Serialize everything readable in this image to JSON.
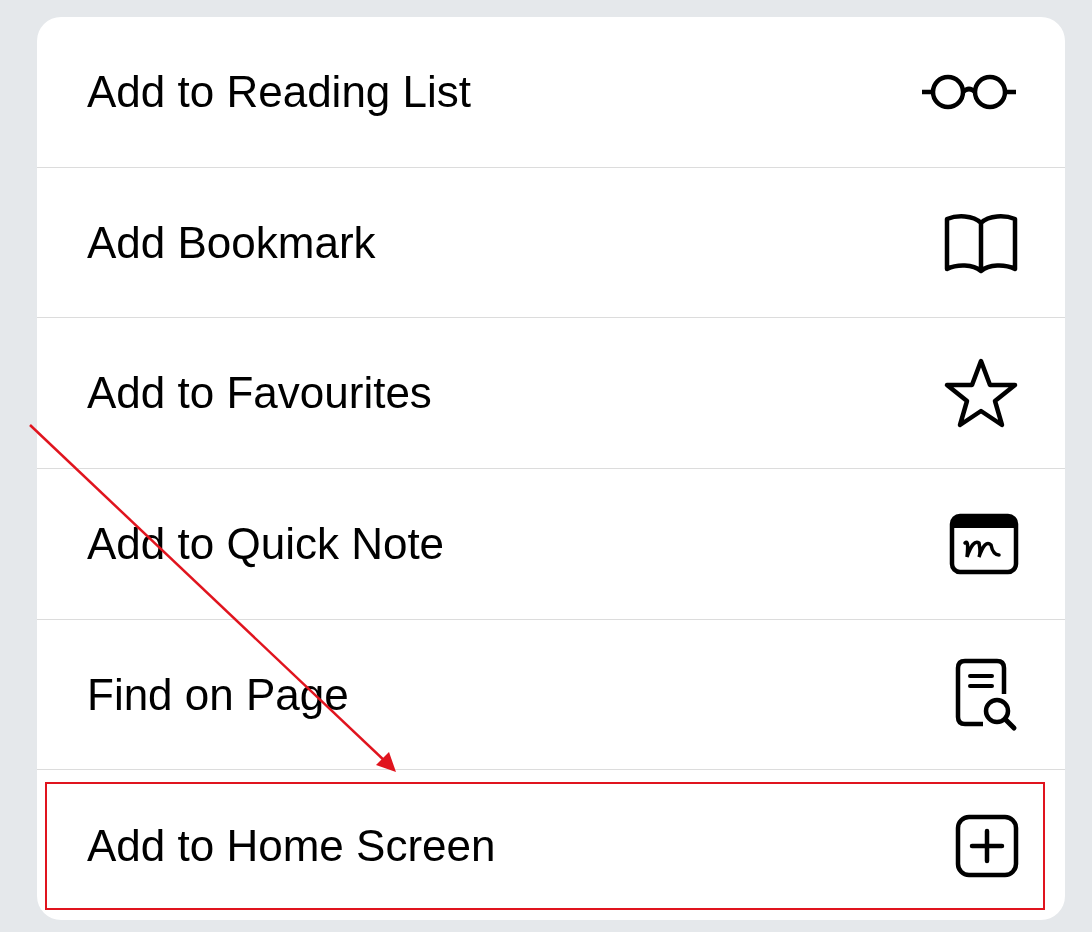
{
  "menu": {
    "items": [
      {
        "label": "Add to Reading List",
        "highlighted": false
      },
      {
        "label": "Add Bookmark",
        "highlighted": false
      },
      {
        "label": "Add to Favourites",
        "highlighted": false
      },
      {
        "label": "Add to Quick Note",
        "highlighted": false
      },
      {
        "label": "Find on Page",
        "highlighted": false
      },
      {
        "label": "Add to Home Screen",
        "highlighted": true
      }
    ]
  }
}
